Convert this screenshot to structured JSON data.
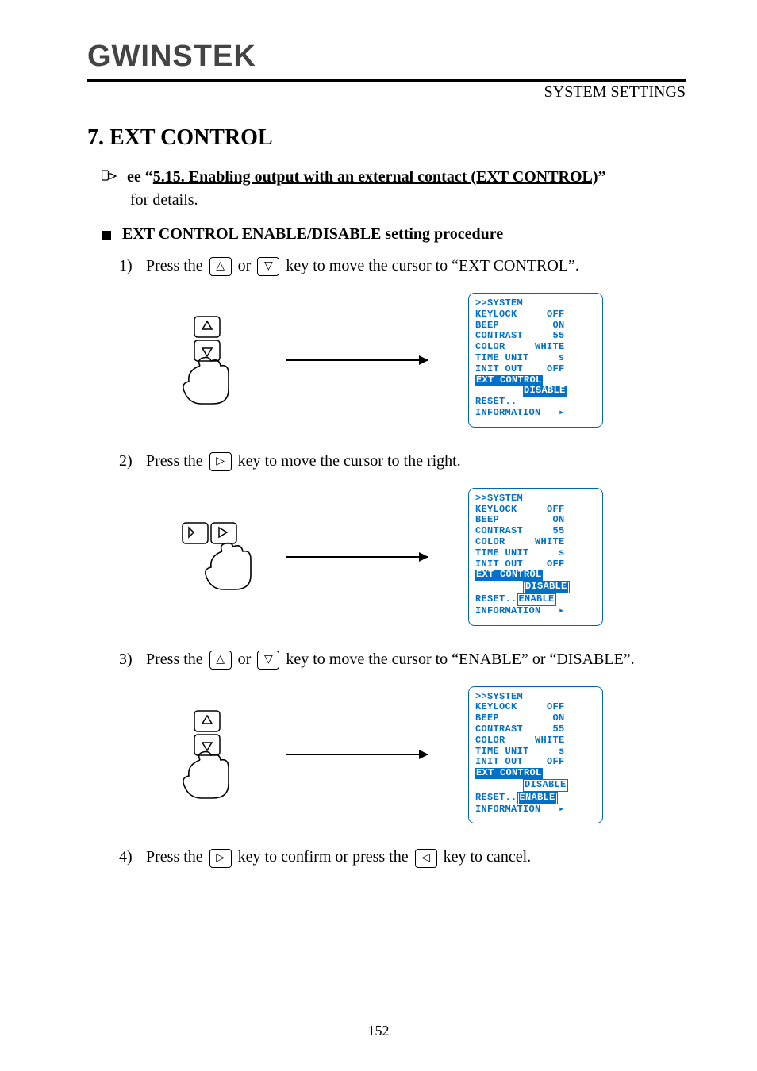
{
  "header": {
    "logo_text": "GWINSTEK",
    "right_text": "SYSTEM SETTINGS"
  },
  "section_title": "7. EXT CONTROL",
  "pointer": {
    "prefix": "ee “",
    "underline": "5.15. Enabling output with an external contact (EXT CONTROL)",
    "suffix": "”"
  },
  "sub_line": "for details.",
  "bullet": "EXT CONTROL ENABLE/DISABLE setting procedure",
  "steps": {
    "s1_a": "1)",
    "s1_b": "Press the ",
    "s1_c": " or ",
    "s1_d": " key to move the cursor to “EXT CONTROL”.",
    "s2_a": "2)",
    "s2_b": "Press the ",
    "s2_c": " key to move the cursor to the right.",
    "s3_a": "3)",
    "s3_b": "Press the ",
    "s3_c": " or ",
    "s3_d": " key to move the cursor to “ENABLE” or “DISABLE”.",
    "s4_a": "4)",
    "s4_b": "Press the ",
    "s4_c": " key to confirm or press the ",
    "s4_d": " key to cancel."
  },
  "lcd_common": {
    "title": ">>SYSTEM",
    "keylock": "KEYLOCK     OFF",
    "beep": "BEEP         ON",
    "contrast": "CONTRAST     55",
    "color": "COLOR     WHITE",
    "timeunit": "TIME UNIT     s",
    "initout": "INIT OUT    OFF",
    "ext": "EXT CONTROL",
    "disable_pad": "        ",
    "disable": "DISABLE",
    "reset": "RESET..",
    "enable_pad": "       ",
    "enable": "ENABLE",
    "info": "INFORMATION   ",
    "arrow_glyph": "▸"
  },
  "footer": "152"
}
